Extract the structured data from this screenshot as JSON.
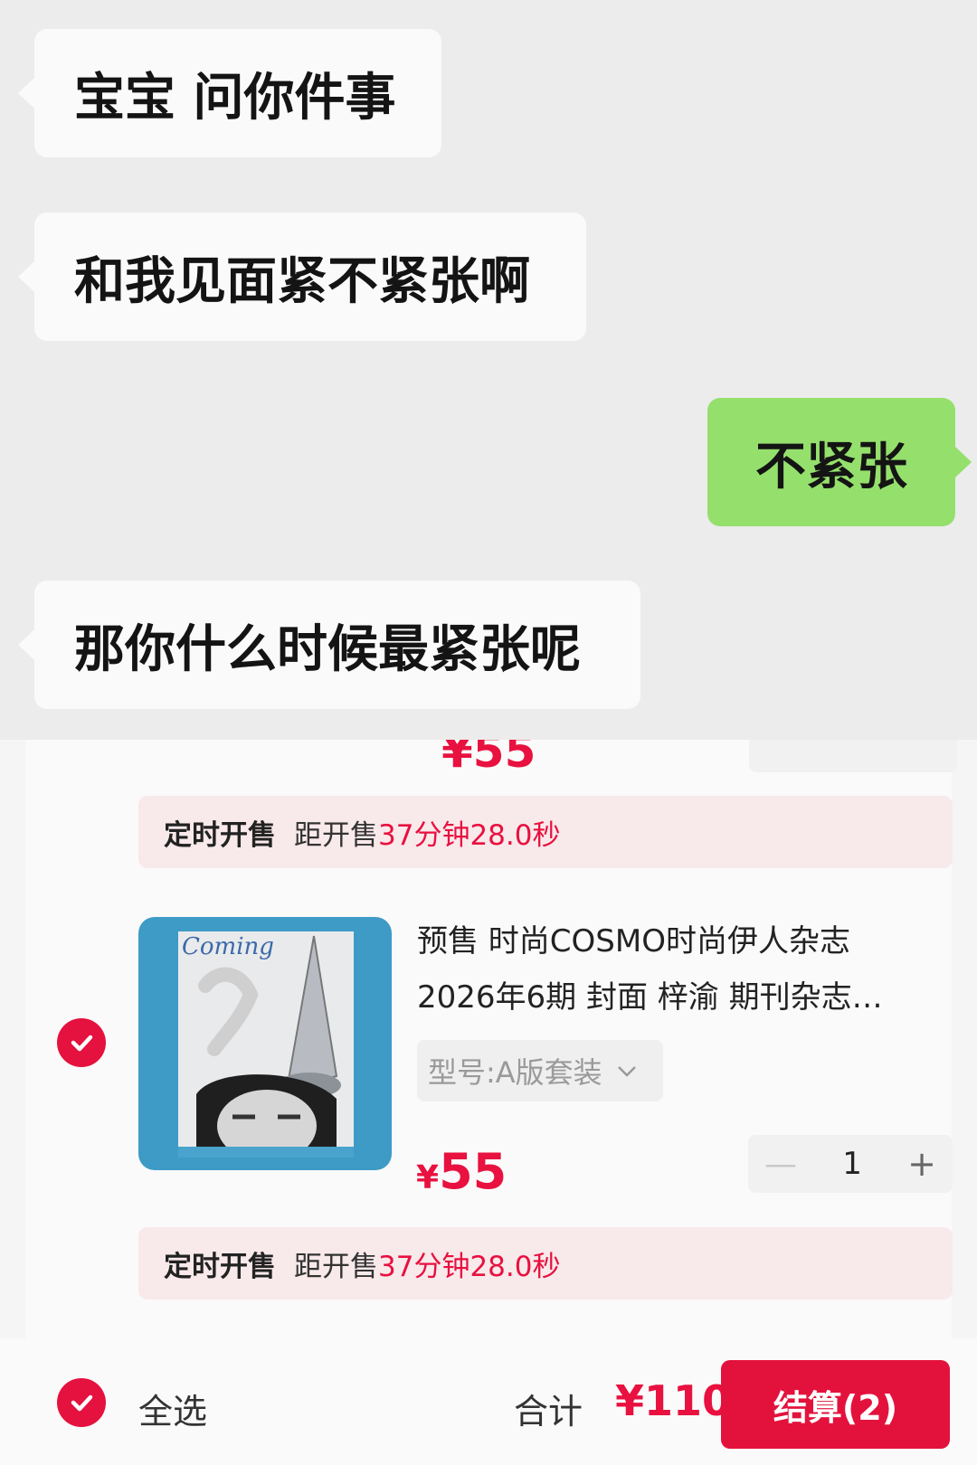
{
  "chat": {
    "messages": [
      {
        "side": "left",
        "text": "宝宝 问你件事"
      },
      {
        "side": "left",
        "text": "和我见面紧不紧张啊"
      },
      {
        "side": "right",
        "text": "不紧张"
      },
      {
        "side": "left",
        "text": "那你什么时候最紧张呢"
      }
    ]
  },
  "cart": {
    "cut_item": {
      "price_text": "¥55"
    },
    "sale_bar_1": {
      "label": "定时开售",
      "prefix": "距开售",
      "countdown": "37分钟28.0秒"
    },
    "item": {
      "cover_text": "Coming",
      "title_line1": "预售 时尚COSMO时尚伊人杂志",
      "title_line2": "2026年6期 封面 梓渝 期刊杂志…",
      "variant": "型号:A版套装",
      "currency": "¥",
      "price": "55",
      "minus": "—",
      "quantity": "1",
      "plus": "+"
    },
    "sale_bar_2": {
      "label": "定时开售",
      "prefix": "距开售",
      "countdown": "37分钟28.0秒"
    }
  },
  "bottom_bar": {
    "select_all": "全选",
    "total_label": "合计",
    "total_value": "¥110",
    "checkout": "结算(2)"
  },
  "colors": {
    "accent_red": "#e8113f",
    "chat_bg": "#ececec",
    "bubble_green": "#95e06c",
    "bubble_white": "#fafafa"
  },
  "icons": [
    "check-circle-icon",
    "chevron-down-icon",
    "minus-icon",
    "plus-icon"
  ]
}
